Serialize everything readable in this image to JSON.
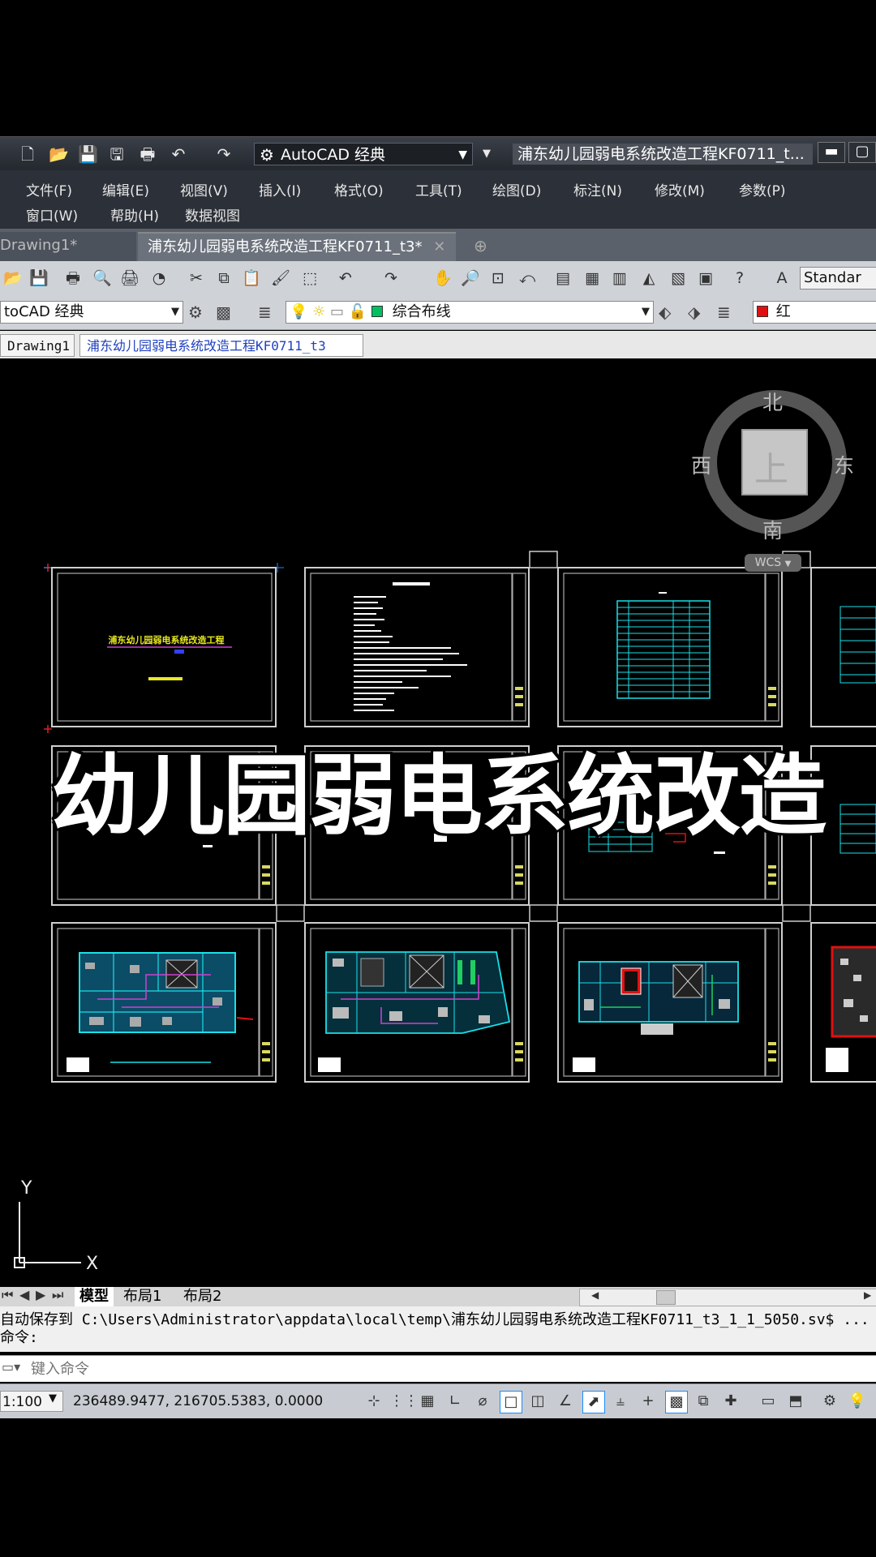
{
  "quick_access": {
    "workspace": "AutoCAD 经典",
    "window_title": "浦东幼儿园弱电系统改造工程KF0711_t...",
    "icons": [
      "new-icon",
      "open-icon",
      "save-icon",
      "save-as-icon",
      "print-icon",
      "undo-icon",
      "redo-icon"
    ]
  },
  "menu": {
    "row1": [
      "文件(F)",
      "编辑(E)",
      "视图(V)",
      "插入(I)",
      "格式(O)",
      "工具(T)",
      "绘图(D)",
      "标注(N)",
      "修改(M)",
      "参数(P)"
    ],
    "row2": [
      "窗口(W)",
      "帮助(H)",
      "数据视图"
    ]
  },
  "doc_tabs": {
    "tab1": "Drawing1*",
    "tab2": "浦东幼儿园弱电系统改造工程KF0711_t3*",
    "close": "✕"
  },
  "toolbar2": {
    "workspace": "toCAD 经典",
    "layer": "综合布线",
    "color": "红",
    "text_style": "Standar"
  },
  "file_tabs": {
    "tab1": "Drawing1",
    "tab2": "浦东幼儿园弱电系统改造工程KF0711_t3"
  },
  "canvas": {
    "sheet1_title": "浦东幼儿园弱电系统改造工程",
    "overlay_title": "幼儿园弱电系统改造",
    "ucs_x": "X",
    "ucs_y": "Y"
  },
  "viewcube": {
    "north": "北",
    "south": "南",
    "east": "东",
    "west": "西",
    "face": "上",
    "wcs": "WCS"
  },
  "layout_tabs": [
    "模型",
    "布局1",
    "布局2"
  ],
  "command": {
    "history_line1": "自动保存到 C:\\Users\\Administrator\\appdata\\local\\temp\\浦东幼儿园弱电系统改造工程KF0711_t3_1_1_5050.sv$ ...",
    "history_line2": "命令:",
    "placeholder": "键入命令"
  },
  "status": {
    "scale": "1:100",
    "coords": "236489.9477, 216705.5383, 0.0000"
  },
  "colors": {
    "cyan": "#19e0e8",
    "yellow": "#e8e820",
    "magenta": "#d040d0",
    "red": "#e01010"
  }
}
